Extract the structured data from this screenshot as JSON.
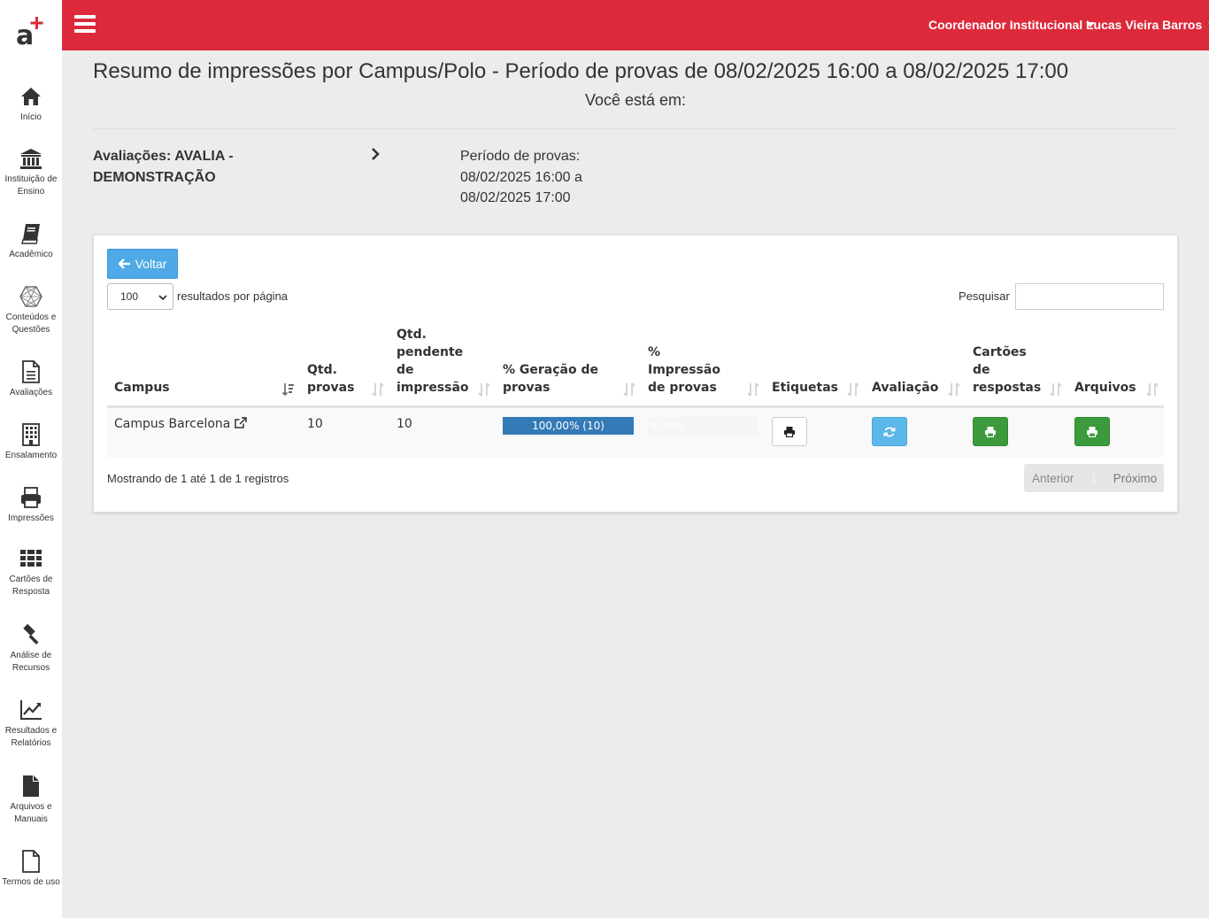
{
  "brand": {
    "accent": "#dc2a3b",
    "logo_text": "a"
  },
  "sidebar": {
    "items": [
      {
        "label": "Início",
        "icon": "home-icon"
      },
      {
        "label": "Instituição de Ensino",
        "icon": "institution-icon"
      },
      {
        "label": "Acadêmico",
        "icon": "book-icon"
      },
      {
        "label": "Conteúdos e Questões",
        "icon": "hexagon-network-icon"
      },
      {
        "label": "Avaliações",
        "icon": "document-icon"
      },
      {
        "label": "Ensalamento",
        "icon": "building-icon"
      },
      {
        "label": "Impressões",
        "icon": "printer-icon"
      },
      {
        "label": "Cartões de Resposta",
        "icon": "grid-icon"
      },
      {
        "label": "Análise de Recursos",
        "icon": "gavel-icon"
      },
      {
        "label": "Resultados e Relatórios",
        "icon": "chart-line-icon"
      },
      {
        "label": "Arquivos e Manuais",
        "icon": "file-icon"
      },
      {
        "label": "Termos de uso",
        "icon": "file-outline-icon"
      }
    ]
  },
  "topbar": {
    "role": "Coordenador Institucional",
    "user": "Lucas Vieira Barros"
  },
  "page": {
    "title": "Resumo de impressões por Campus/Polo - Período de provas de 08/02/2025 16:00 a 08/02/2025 17:00",
    "breadcrumb_label": "Você está em:",
    "evaluation_label": "Avaliações: AVALIA - DEMONSTRAÇÃO",
    "period_label": "Período de provas:",
    "period_line1": "08/02/2025 16:00 a",
    "period_line2": "08/02/2025 17:00"
  },
  "controls": {
    "back_label": "Voltar",
    "page_length": "100",
    "page_length_suffix": "resultados por página",
    "search_label": "Pesquisar",
    "search_value": ""
  },
  "table": {
    "headers": {
      "campus": "Campus",
      "qtd_provas": "Qtd. provas",
      "qtd_pendente": "Qtd. pendente de impressão",
      "geracao": "% Geração de provas",
      "impressao": "% Impressão de provas",
      "etiquetas": "Etiquetas",
      "avaliacao": "Avaliação",
      "cartoes": "Cartões de respostas",
      "arquivos": "Arquivos"
    },
    "rows": [
      {
        "campus": "Campus Barcelona",
        "qtd_provas": "10",
        "qtd_pendente": "10",
        "geracao_label": "100,00% (10)",
        "geracao_percent": 100,
        "impressao_label": "0,00%",
        "impressao_percent": 0
      }
    ]
  },
  "footer": {
    "info": "Mostrando de 1 até 1 de 1 registros",
    "prev": "Anterior",
    "page": "1",
    "next": "Próximo"
  }
}
